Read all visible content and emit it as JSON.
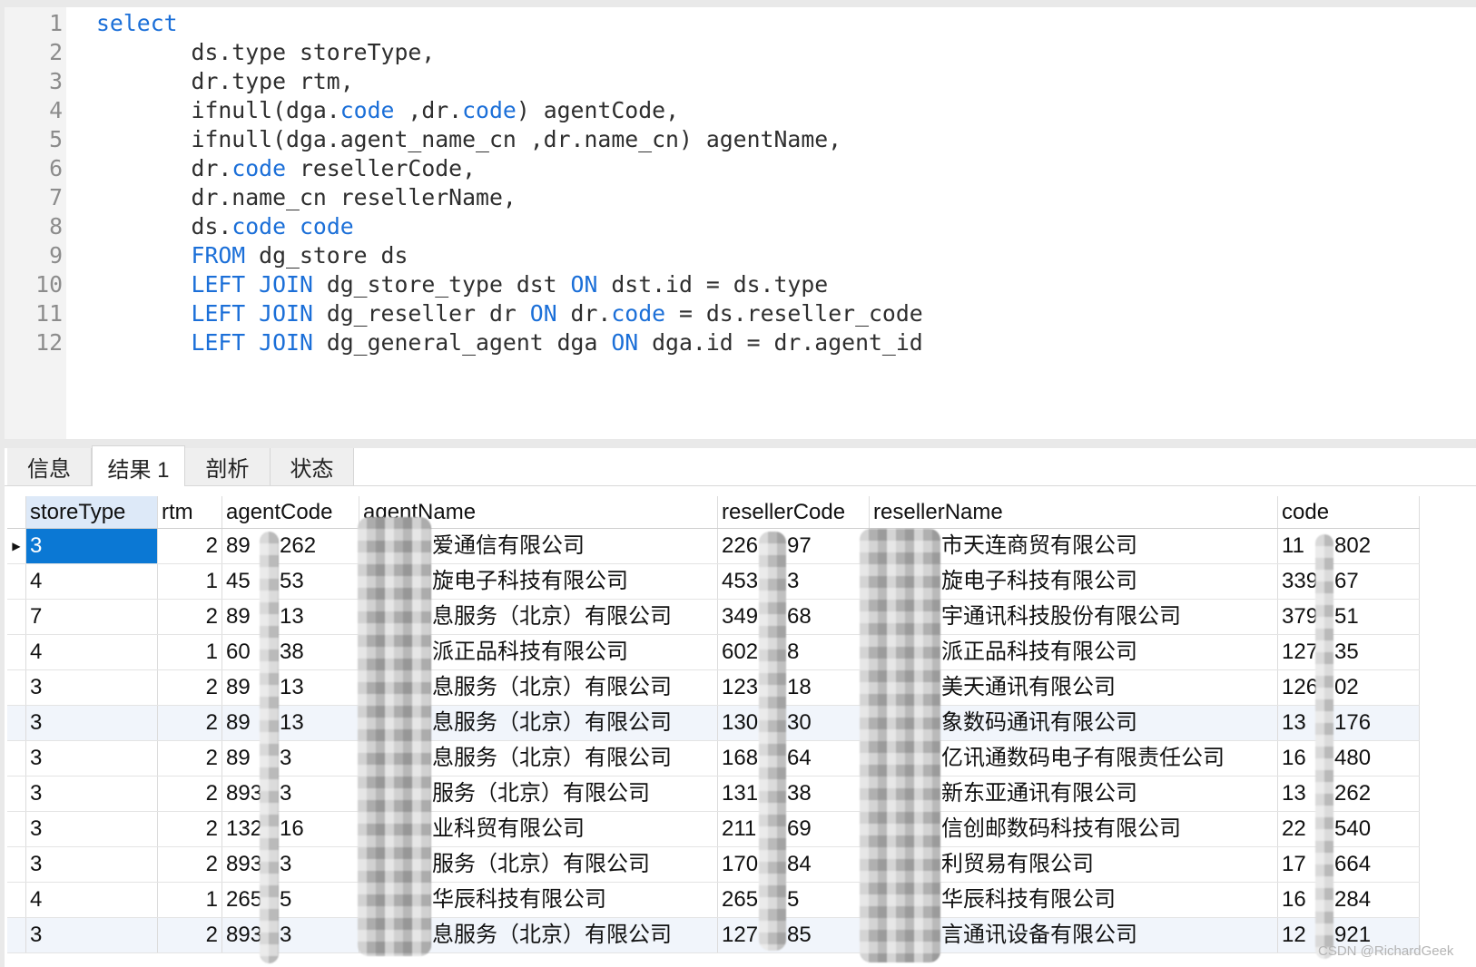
{
  "colors": {
    "keyword": "#1b6fd8",
    "selected_cell": "#0b78d4"
  },
  "editor": {
    "lines": [
      {
        "number": "1",
        "tokens": [
          {
            "kind": "keyword",
            "text": "select"
          }
        ]
      },
      {
        "number": "2",
        "tokens": [
          {
            "kind": "plain",
            "text": "\tds.type storeType,"
          }
        ]
      },
      {
        "number": "3",
        "tokens": [
          {
            "kind": "plain",
            "text": "\tdr.type rtm,"
          }
        ]
      },
      {
        "number": "4",
        "tokens": [
          {
            "kind": "plain",
            "text": "\tifnull(dga."
          },
          {
            "kind": "keyword",
            "text": "code"
          },
          {
            "kind": "plain",
            "text": " ,dr."
          },
          {
            "kind": "keyword",
            "text": "code"
          },
          {
            "kind": "plain",
            "text": ") agentCode,"
          }
        ]
      },
      {
        "number": "5",
        "tokens": [
          {
            "kind": "plain",
            "text": "\tifnull(dga.agent_name_cn ,dr.name_cn) agentName,"
          }
        ]
      },
      {
        "number": "6",
        "tokens": [
          {
            "kind": "plain",
            "text": "\tdr."
          },
          {
            "kind": "keyword",
            "text": "code"
          },
          {
            "kind": "plain",
            "text": " resellerCode,"
          }
        ]
      },
      {
        "number": "7",
        "tokens": [
          {
            "kind": "plain",
            "text": "\tdr.name_cn resellerName,"
          }
        ]
      },
      {
        "number": "8",
        "tokens": [
          {
            "kind": "plain",
            "text": "\tds."
          },
          {
            "kind": "keyword",
            "text": "code"
          },
          {
            "kind": "plain",
            "text": " "
          },
          {
            "kind": "keyword",
            "text": "code"
          }
        ]
      },
      {
        "number": "9",
        "tokens": [
          {
            "kind": "plain",
            "text": "\t"
          },
          {
            "kind": "keyword",
            "text": "FROM"
          },
          {
            "kind": "plain",
            "text": " dg_store ds"
          }
        ]
      },
      {
        "number": "10",
        "tokens": [
          {
            "kind": "plain",
            "text": "\t"
          },
          {
            "kind": "keyword",
            "text": "LEFT JOIN"
          },
          {
            "kind": "plain",
            "text": " dg_store_type dst "
          },
          {
            "kind": "keyword",
            "text": "ON"
          },
          {
            "kind": "plain",
            "text": " dst.id = ds.type"
          }
        ]
      },
      {
        "number": "11",
        "tokens": [
          {
            "kind": "plain",
            "text": "\t"
          },
          {
            "kind": "keyword",
            "text": "LEFT JOIN"
          },
          {
            "kind": "plain",
            "text": " dg_reseller dr "
          },
          {
            "kind": "keyword",
            "text": "ON"
          },
          {
            "kind": "plain",
            "text": " dr."
          },
          {
            "kind": "keyword",
            "text": "code"
          },
          {
            "kind": "plain",
            "text": " = ds.reseller_code"
          }
        ]
      },
      {
        "number": "12",
        "tokens": [
          {
            "kind": "plain",
            "text": "\t"
          },
          {
            "kind": "keyword",
            "text": "LEFT JOIN"
          },
          {
            "kind": "plain",
            "text": " dg_general_agent dga "
          },
          {
            "kind": "keyword",
            "text": "ON"
          },
          {
            "kind": "plain",
            "text": " dga.id = dr.agent_id"
          }
        ]
      }
    ]
  },
  "tabs": [
    {
      "label": "信息"
    },
    {
      "label": "结果 1",
      "active": true
    },
    {
      "label": "剖析"
    },
    {
      "label": "状态"
    }
  ],
  "grid": {
    "columns": [
      "storeType",
      "rtm",
      "agentCode",
      "agentName",
      "resellerCode",
      "resellerName",
      "code"
    ],
    "selection": {
      "row": 1,
      "column": "storeType"
    },
    "rows": [
      {
        "storeType": "3",
        "rtm": "2",
        "agentCode": {
          "start": "89",
          "end": "262"
        },
        "agentName": {
          "end": "爱通信有限公司"
        },
        "resellerCode": {
          "start": "226",
          "end": "97"
        },
        "resellerName": {
          "end": "市天连商贸有限公司"
        },
        "code": {
          "start": "11",
          "end": "802"
        }
      },
      {
        "storeType": "4",
        "rtm": "1",
        "agentCode": {
          "start": "45",
          "end": "53"
        },
        "agentName": {
          "end": "旋电子科技有限公司"
        },
        "resellerCode": {
          "start": "453",
          "end": "3"
        },
        "resellerName": {
          "end": "旋电子科技有限公司"
        },
        "code": {
          "start": "339",
          "end": "67"
        }
      },
      {
        "storeType": "7",
        "rtm": "2",
        "agentCode": {
          "start": "89",
          "end": "13"
        },
        "agentName": {
          "end": "息服务（北京）有限公司"
        },
        "resellerCode": {
          "start": "349",
          "end": "68"
        },
        "resellerName": {
          "end": "宇通讯科技股份有限公司"
        },
        "code": {
          "start": "379",
          "end": "51"
        }
      },
      {
        "storeType": "4",
        "rtm": "1",
        "agentCode": {
          "start": "60",
          "end": "38"
        },
        "agentName": {
          "end": "派正品科技有限公司"
        },
        "resellerCode": {
          "start": "602",
          "end": "8"
        },
        "resellerName": {
          "end": "派正品科技有限公司"
        },
        "code": {
          "start": "127",
          "end": "35"
        }
      },
      {
        "storeType": "3",
        "rtm": "2",
        "agentCode": {
          "start": "89",
          "end": "13"
        },
        "agentName": {
          "end": "息服务（北京）有限公司"
        },
        "resellerCode": {
          "start": "123",
          "end": "18"
        },
        "resellerName": {
          "end": "美天通讯有限公司"
        },
        "code": {
          "start": "126",
          "end": "02"
        }
      },
      {
        "storeType": "3",
        "rtm": "2",
        "agentCode": {
          "start": "89",
          "end": "13"
        },
        "agentName": {
          "end": "息服务（北京）有限公司"
        },
        "resellerCode": {
          "start": "130",
          "end": "30"
        },
        "resellerName": {
          "end": "象数码通讯有限公司"
        },
        "code": {
          "start": "13",
          "end": "176"
        }
      },
      {
        "storeType": "3",
        "rtm": "2",
        "agentCode": {
          "start": "89",
          "end": "3"
        },
        "agentName": {
          "end": "息服务（北京）有限公司"
        },
        "resellerCode": {
          "start": "168",
          "end": "64"
        },
        "resellerName": {
          "end": "亿讯通数码电子有限责任公司"
        },
        "code": {
          "start": "16",
          "end": "480"
        }
      },
      {
        "storeType": "3",
        "rtm": "2",
        "agentCode": {
          "start": "893",
          "end": "3"
        },
        "agentName": {
          "end": "服务（北京）有限公司"
        },
        "resellerCode": {
          "start": "131",
          "end": "38"
        },
        "resellerName": {
          "end": "新东亚通讯有限公司"
        },
        "code": {
          "start": "13",
          "end": "262"
        }
      },
      {
        "storeType": "3",
        "rtm": "2",
        "agentCode": {
          "start": "132",
          "end": "16"
        },
        "agentName": {
          "end": "业科贸有限公司"
        },
        "resellerCode": {
          "start": "211",
          "end": "69"
        },
        "resellerName": {
          "end": "信创邮数码科技有限公司"
        },
        "code": {
          "start": "22",
          "end": "540"
        }
      },
      {
        "storeType": "3",
        "rtm": "2",
        "agentCode": {
          "start": "893",
          "end": "3"
        },
        "agentName": {
          "end": "服务（北京）有限公司"
        },
        "resellerCode": {
          "start": "170",
          "end": "84"
        },
        "resellerName": {
          "end": "利贸易有限公司"
        },
        "code": {
          "start": "17",
          "end": "664"
        }
      },
      {
        "storeType": "4",
        "rtm": "1",
        "agentCode": {
          "start": "265",
          "end": "5"
        },
        "agentName": {
          "end": "华辰科技有限公司"
        },
        "resellerCode": {
          "start": "265",
          "end": "5"
        },
        "resellerName": {
          "end": "华辰科技有限公司"
        },
        "code": {
          "start": "16",
          "end": "284"
        }
      },
      {
        "storeType": "3",
        "rtm": "2",
        "agentCode": {
          "start": "893",
          "end": "3"
        },
        "agentName": {
          "end": "息服务（北京）有限公司"
        },
        "resellerCode": {
          "start": "127",
          "end": "85"
        },
        "resellerName": {
          "end": "言通讯设备有限公司"
        },
        "code": {
          "start": "12",
          "end": "921"
        }
      }
    ]
  },
  "watermark": "CSDN @RichardGeek"
}
